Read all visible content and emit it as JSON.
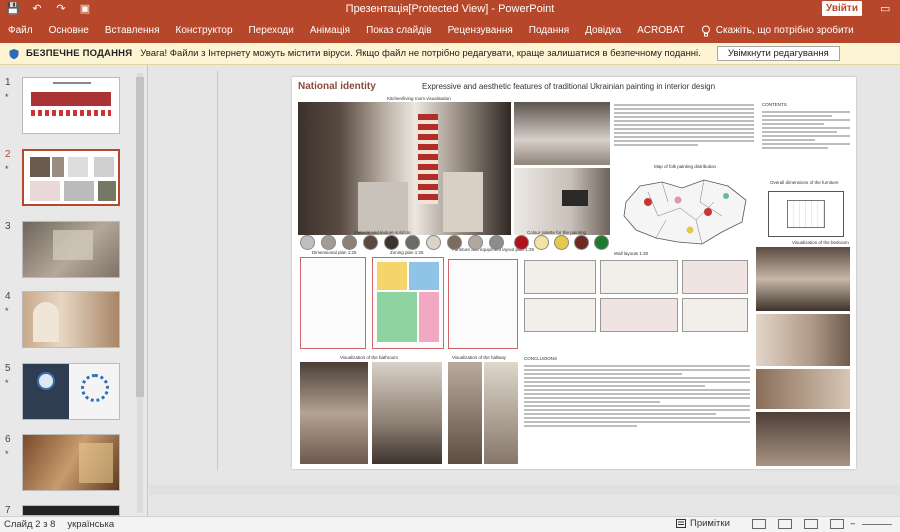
{
  "window": {
    "title": "Презентація[Protected View]  -  PowerPoint",
    "signin": "Увійти",
    "quick_access": [
      "💾",
      "↶",
      "↷",
      "▣"
    ],
    "restore_icon": "▭"
  },
  "ribbon": {
    "tabs": [
      "Файл",
      "Основне",
      "Вставлення",
      "Конструктор",
      "Переходи",
      "Анімація",
      "Показ слайдів",
      "Рецензування",
      "Подання",
      "Довідка",
      "ACROBAT"
    ],
    "tell_me": "Скажіть, що потрібно зробити"
  },
  "protected_view": {
    "heading": "БЕЗПЕЧНЕ ПОДАННЯ",
    "message": "Увага! Файли з Інтернету можуть містити віруси. Якщо файл не потрібно редагувати, краще залишатися в безпечному поданні.",
    "enable_button": "Увімкнути редагування"
  },
  "thumbnails": [
    {
      "num": "1",
      "star": "*"
    },
    {
      "num": "2",
      "star": "*",
      "active": true
    },
    {
      "num": "3",
      "star": ""
    },
    {
      "num": "4",
      "star": "*"
    },
    {
      "num": "5",
      "star": "*"
    },
    {
      "num": "6",
      "star": "*"
    },
    {
      "num": "7",
      "star": ""
    }
  ],
  "slide": {
    "title": "National identity",
    "subtitle": "Expressive and aesthetic features of traditional Ukrainian painting in interior design",
    "captions": {
      "kitchen": "Kitchen/living room visualisation",
      "materials": "Material and texture solution",
      "palette": "Colour palette for the painting",
      "map": "Map of folk painting distribution",
      "furniture_dims": "Overall dimensions of the furniture",
      "dimensional_plan": "Dimensional plan  1:25",
      "zoning_plan": "Zoning plan 1:25",
      "furniture_layout": "Furniture and equipment layout plan  1:25",
      "wall_layouts": "Wall layouts 1:30",
      "bedroom": "Visualization of the bedroom",
      "bathroom": "Visualization of the bathroom",
      "hallway": "Visualization of the hallway",
      "conclusions": "CONCLUSIONS",
      "contents": "CONTENTS"
    },
    "material_colors": [
      "#bfbfbf",
      "#a39c95",
      "#8b8178",
      "#5a4a40",
      "#3a3330",
      "#6d6a66",
      "#d9d3c8",
      "#7b6b5d",
      "#b0a89c",
      "#8c8c8c"
    ],
    "palette_colors": [
      "#b3121b",
      "#f2e3a0",
      "#e6c84a",
      "#6e2a22",
      "#1e7a2f"
    ]
  },
  "status": {
    "slide_info": "Слайд 2 з 8",
    "language": "українська",
    "notes": "Примітки",
    "zoom_minus": "−"
  }
}
